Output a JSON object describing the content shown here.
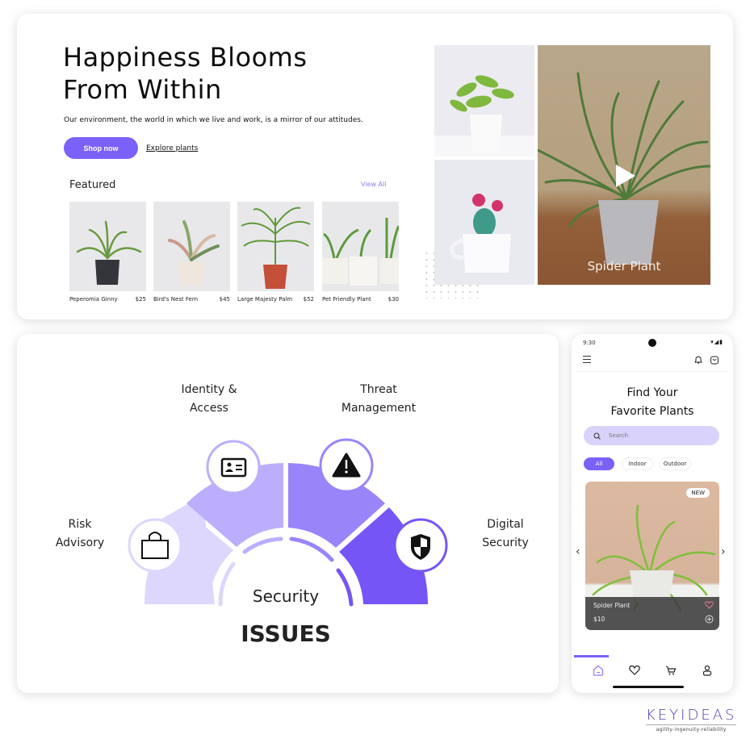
{
  "hero": {
    "title_line1": "Happiness Blooms",
    "title_line2": "From Within",
    "subtitle": "Our environment, the world in which we live and work, is a mirror of our attitudes.",
    "shop_button": "Shop now",
    "explore_link": "Explore plants",
    "featured_title": "Featured",
    "view_all": "View All",
    "products": [
      {
        "name": "Peperomia Ginny",
        "price": "$25"
      },
      {
        "name": "Bird's Nest Fern",
        "price": "$45"
      },
      {
        "name": "Large Majesty Palm",
        "price": "$52"
      },
      {
        "name": "Pet Friendly Plant",
        "price": "$30"
      }
    ],
    "video_caption": "Spider Plant",
    "accent_color": "#7b61f8"
  },
  "security": {
    "center_top": "Security",
    "center_bottom": "ISSUES",
    "segments": [
      {
        "label_line1": "Risk",
        "label_line2": "Advisory",
        "icon": "shopping-bag-icon",
        "color": "#ddd6fd"
      },
      {
        "label_line1": "Identity &",
        "label_line2": "Access",
        "icon": "id-card-icon",
        "color": "#bcaefc"
      },
      {
        "label_line1": "Threat",
        "label_line2": "Management",
        "icon": "warning-icon",
        "color": "#9a84fa"
      },
      {
        "label_line1": "Digital",
        "label_line2": "Security",
        "icon": "shield-icon",
        "color": "#7655f6"
      }
    ]
  },
  "phone": {
    "time": "9:30",
    "title_line1": "Find Your",
    "title_line2": "Favorite Plants",
    "search_placeholder": "Search",
    "filters": [
      "All",
      "Indoor",
      "Outdoor"
    ],
    "active_filter": "All",
    "card": {
      "badge": "NEW",
      "name": "Spider Plant",
      "price": "$10"
    },
    "nav": [
      "home-icon",
      "heart-icon",
      "cart-icon",
      "profile-icon"
    ]
  },
  "brand": {
    "name": "KEYIDEAS",
    "tagline": "agility-ingenuity-reliability"
  }
}
